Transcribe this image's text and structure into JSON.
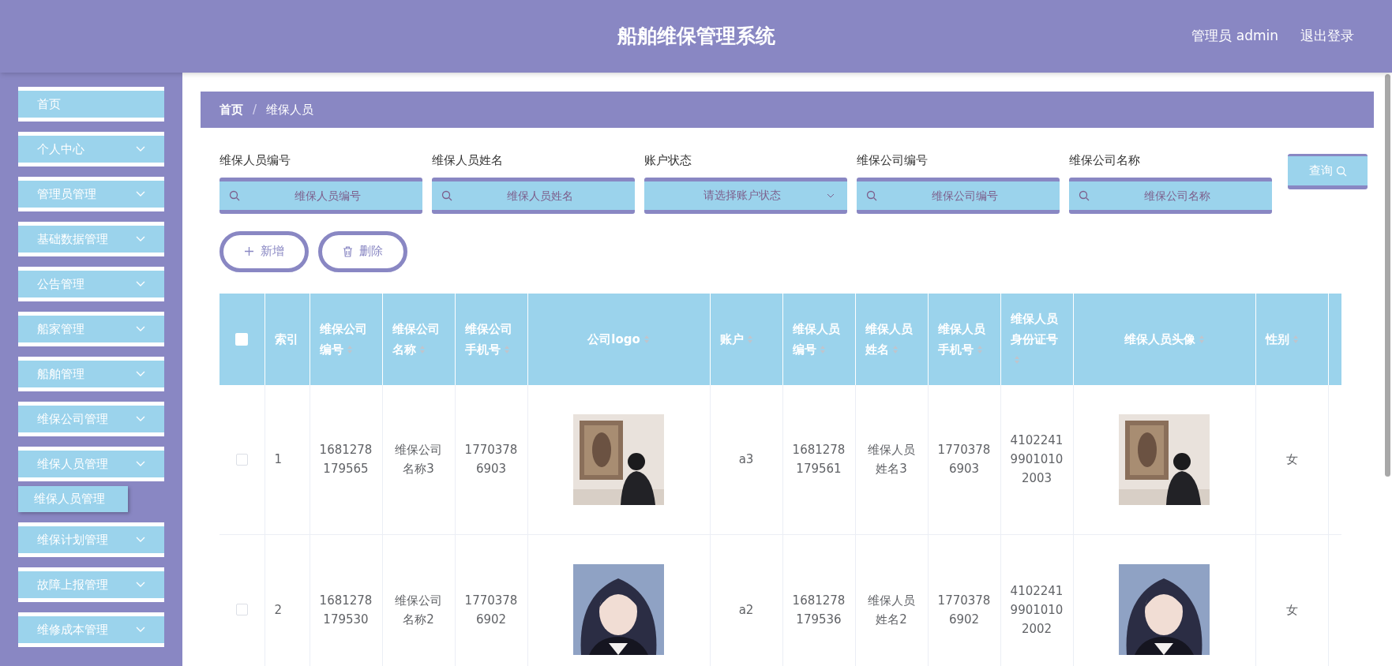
{
  "header": {
    "title": "船舶维保管理系统",
    "user": "管理员 admin",
    "logout": "退出登录"
  },
  "sidebar": {
    "items": [
      {
        "label": "首页",
        "kind": "link"
      },
      {
        "label": "个人中心",
        "kind": "menu"
      },
      {
        "label": "管理员管理",
        "kind": "menu"
      },
      {
        "label": "基础数据管理",
        "kind": "menu"
      },
      {
        "label": "公告管理",
        "kind": "menu"
      },
      {
        "label": "船家管理",
        "kind": "menu"
      },
      {
        "label": "船舶管理",
        "kind": "menu"
      },
      {
        "label": "维保公司管理",
        "kind": "menu"
      },
      {
        "label": "维保人员管理",
        "kind": "menu",
        "children": [
          {
            "label": "维保人员管理"
          }
        ]
      },
      {
        "label": "维保计划管理",
        "kind": "menu"
      },
      {
        "label": "故障上报管理",
        "kind": "menu"
      },
      {
        "label": "维修成本管理",
        "kind": "menu"
      }
    ]
  },
  "breadcrumb": {
    "items": [
      "首页",
      "维保人员"
    ],
    "separator": "/"
  },
  "filters": [
    {
      "label": "维保人员编号",
      "placeholder": "维保人员编号",
      "kind": "text"
    },
    {
      "label": "维保人员姓名",
      "placeholder": "维保人员姓名",
      "kind": "text"
    },
    {
      "label": "账户状态",
      "placeholder": "请选择账户状态",
      "kind": "select"
    },
    {
      "label": "维保公司编号",
      "placeholder": "维保公司编号",
      "kind": "text"
    },
    {
      "label": "维保公司名称",
      "placeholder": "维保公司名称",
      "kind": "text"
    }
  ],
  "search_button": "查询",
  "actions": [
    {
      "label": "新增",
      "kind": "add"
    },
    {
      "label": "删除",
      "kind": "delete"
    }
  ],
  "table": {
    "select_all": false,
    "columns": [
      {
        "label": "索引",
        "sortable": false,
        "kind": "text"
      },
      {
        "label": "维保公司编号",
        "sortable": true,
        "kind": "text"
      },
      {
        "label": "维保公司名称",
        "sortable": true,
        "kind": "text"
      },
      {
        "label": "维保公司手机号",
        "sortable": true,
        "kind": "text"
      },
      {
        "label": "公司logo",
        "sortable": true
      },
      {
        "label": "账户",
        "sortable": true,
        "kind": "text"
      },
      {
        "label": "维保人员编号",
        "sortable": true,
        "kind": "text"
      },
      {
        "label": "维保人员姓名",
        "sortable": true,
        "kind": "text"
      },
      {
        "label": "维保人员手机号",
        "sortable": true,
        "kind": "text"
      },
      {
        "label": "维保人员身份证号",
        "sortable": true,
        "kind": "text"
      },
      {
        "label": "维保人员头像",
        "sortable": true
      },
      {
        "label": "性别",
        "sortable": true,
        "kind": "text"
      }
    ],
    "rows": [
      {
        "checked": false,
        "cells": [
          "1",
          "1681278179565",
          "维保公司名称3",
          "17703786903",
          {
            "kind": "picture"
          },
          "a3",
          "1681278179561",
          "维保人员姓名3",
          "17703786903",
          "410224199010102003",
          {
            "kind": "picture"
          },
          "女"
        ]
      },
      {
        "checked": false,
        "cells": [
          "2",
          "1681278179530",
          "维保公司名称2",
          "17703786902",
          {
            "kind": "picture"
          },
          "a2",
          "1681278179536",
          "维保人员姓名2",
          "17703786902",
          "410224199010102002",
          {
            "kind": "picture"
          },
          "女"
        ]
      }
    ]
  }
}
